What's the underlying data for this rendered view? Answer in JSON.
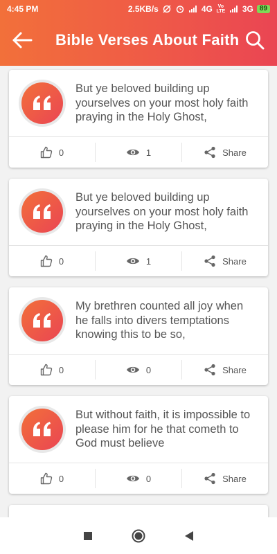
{
  "status_bar": {
    "time": "4:45 PM",
    "speed": "2.5KB/s",
    "network_1": "4G",
    "network_1_tag": "Vo LTE",
    "network_2": "3G",
    "battery": "89"
  },
  "app_bar": {
    "title": "Bible Verses About Faith",
    "back_icon": "arrow-left-icon",
    "search_icon": "search-icon"
  },
  "verses": [
    {
      "text": "But ye beloved building up yourselves on your most holy faith praying in the Holy Ghost,",
      "likes": "0",
      "views": "1",
      "share_label": "Share"
    },
    {
      "text": "But ye beloved building up yourselves on your most holy faith praying in the Holy Ghost,",
      "likes": "0",
      "views": "1",
      "share_label": "Share"
    },
    {
      "text": "My brethren counted all joy when he falls into divers temptations knowing this to be so,",
      "likes": "0",
      "views": "0",
      "share_label": "Share"
    },
    {
      "text": "But without faith, it is impossible to please him for he that cometh to God must believe",
      "likes": "0",
      "views": "0",
      "share_label": "Share"
    }
  ],
  "colors": {
    "gradient_start": "#f2703a",
    "gradient_end": "#ea4553",
    "text": "#555555",
    "icon": "#666666"
  },
  "nav_bar": {
    "recent_icon": "square-icon",
    "home_icon": "circle-icon",
    "back_icon": "triangle-back-icon"
  }
}
